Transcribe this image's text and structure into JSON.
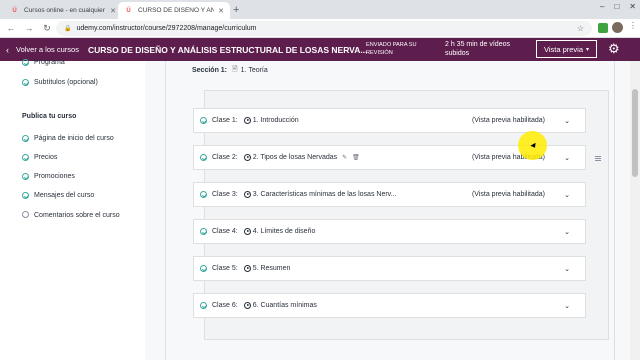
{
  "browser": {
    "tabs": [
      {
        "title": "Cursos online - en cualquier mo",
        "active": false
      },
      {
        "title": "CURSO DE DISEÑO Y ANÁLISIS E",
        "active": true
      }
    ],
    "new_tab": "+",
    "url": "udemy.com/instructor/course/2972208/manage/curriculum",
    "controls": {
      "minimize": "–",
      "maximize": "□",
      "close": "✕"
    }
  },
  "header": {
    "back_label": "Volver a los cursos",
    "course_title": "CURSO DE DISEÑO Y ANÁLISIS ESTRUCTURAL DE LOSAS NERVA...",
    "review_status": "ENVIADO PARA SU REVISIÓN",
    "video_duration": "2 h 35 min de vídeos subidos",
    "preview_button": "Vista previa",
    "colors": {
      "header_bg": "#5d1e4e",
      "accent": "#ec5252"
    }
  },
  "sidebar": {
    "top_items": [
      {
        "label": "Programa",
        "done": true
      },
      {
        "label": "Subtítulos (opcional)",
        "done": true
      }
    ],
    "publish_heading": "Publica tu curso",
    "publish_items": [
      {
        "label": "Página de inicio del curso",
        "done": true
      },
      {
        "label": "Precios",
        "done": true
      },
      {
        "label": "Promociones",
        "done": true
      },
      {
        "label": "Mensajes del curso",
        "done": true
      },
      {
        "label": "Comentarios sobre el curso",
        "done": false
      }
    ]
  },
  "curriculum": {
    "section_label": "Sección 1:",
    "section_title": "1. Teoría",
    "lectures": [
      {
        "label": "Clase 1:",
        "title": "1. Introducción",
        "preview": "(Vista previa habilitada)",
        "editing": false
      },
      {
        "label": "Clase 2:",
        "title": "2. Tipos de losas Nervadas",
        "preview": "(Vista previa habilitada)",
        "editing": true
      },
      {
        "label": "Clase 3:",
        "title": "3. Características mínimas de las losas Nerv...",
        "preview": "(Vista previa habilitada)",
        "editing": false
      },
      {
        "label": "Clase 4:",
        "title": "4. Límites de diseño",
        "preview": "",
        "editing": false
      },
      {
        "label": "Clase 5:",
        "title": "5. Resumen",
        "preview": "",
        "editing": false
      },
      {
        "label": "Clase 6:",
        "title": "6. Cuantías mínimas",
        "preview": "",
        "editing": false
      }
    ]
  },
  "icons": {
    "check": "check-circle-icon",
    "play": "play-circle-icon",
    "expand": "chevron-down-icon",
    "settings": "gear-icon",
    "edit": "pencil-icon",
    "delete": "trash-icon"
  }
}
